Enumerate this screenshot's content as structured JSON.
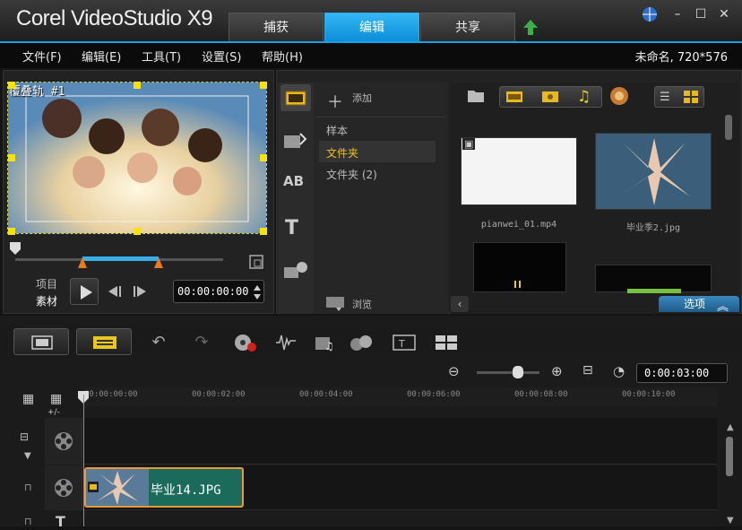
{
  "app": {
    "logo_text": "Corel VideoStudio X9"
  },
  "tabs": [
    {
      "label": "捕获"
    },
    {
      "label": "编辑"
    },
    {
      "label": "共享"
    }
  ],
  "menu": [
    {
      "label": "文件(F)"
    },
    {
      "label": "编辑(E)"
    },
    {
      "label": "工具(T)"
    },
    {
      "label": "设置(S)"
    },
    {
      "label": "帮助(H)"
    }
  ],
  "project": {
    "info": "未命名, 720*576"
  },
  "preview": {
    "overlay_label": "覆叠轨 #1",
    "mode_project": "项目",
    "mode_clip": "素材",
    "timecode": "00:00:00:00"
  },
  "library": {
    "add_label": "添加",
    "browse_label": "浏览",
    "folders": [
      {
        "label": "样本"
      },
      {
        "label": "文件夹"
      },
      {
        "label": "文件夹 (2)"
      }
    ],
    "media": [
      {
        "label": "pianwei_01.mp4"
      },
      {
        "label": "毕业季2.jpg"
      },
      {
        "label": ""
      },
      {
        "label": ""
      }
    ],
    "options_label": "选项"
  },
  "timeline": {
    "timecode": "0:00:03:00",
    "ruler_ticks": [
      "00:00:00:00",
      "00:00:02:00",
      "00:00:04:00",
      "00:00:06:00",
      "00:00:08:00",
      "00:00:10:00"
    ],
    "clip_label": "毕业14.JPG",
    "add_track_label": "+/-"
  },
  "colors": {
    "accent": "#1aa0e8",
    "clip": "#1a6b5c",
    "clip_border": "#e89a30"
  }
}
